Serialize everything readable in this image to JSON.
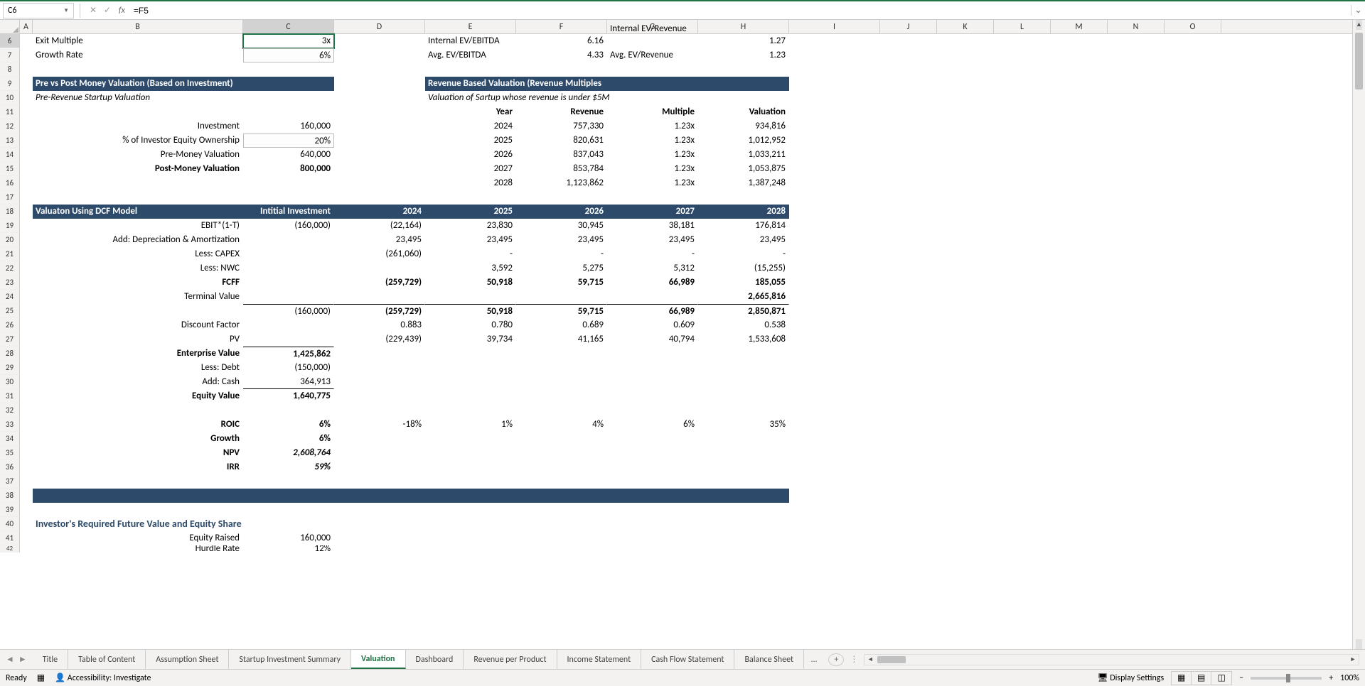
{
  "nameBox": "C6",
  "formula": "=F5",
  "statusReady": "Ready",
  "accessibility": "Accessibility: Investigate",
  "displaySettings": "Display Settings",
  "zoom": "100%",
  "colLabels": [
    "A",
    "B",
    "C",
    "D",
    "E",
    "F",
    "G",
    "H",
    "I",
    "J",
    "K",
    "L",
    "M",
    "N",
    "O"
  ],
  "rowStart": 6,
  "rows": {
    "r6": {
      "B": "Exit Multiple",
      "C": "3x",
      "E": "Internal EV/EBITDA",
      "F": "6.16",
      "G_over": "Internal EV/Revenue",
      "H": "1.27"
    },
    "r7": {
      "B": "Growth Rate",
      "C": "6%",
      "E": "Avg. EV/EBITDA",
      "F": "4.33",
      "G": "Avg. EV/Revenue",
      "H": "1.23"
    },
    "r9": {
      "B": "Pre vs Post Money Valuation (Based on Investment)",
      "E": "Revenue Based Valuation (Revenue Multiples"
    },
    "r10": {
      "B": "Pre-Revenue Startup Valuation",
      "E": "Valuation of Sartup whose revenue is under $5M"
    },
    "r11": {
      "E": "Year",
      "F": "Revenue",
      "G": "Multiple",
      "H": "Valuation"
    },
    "r12": {
      "B": "Investment",
      "C": "160,000",
      "E": "2024",
      "F": "757,330",
      "G": "1.23x",
      "H": "934,816"
    },
    "r13": {
      "B": "% of Investor Equity Ownership",
      "C": "20%",
      "E": "2025",
      "F": "820,631",
      "G": "1.23x",
      "H": "1,012,952"
    },
    "r14": {
      "B": "Pre-Money Valuation",
      "C": "640,000",
      "E": "2026",
      "F": "837,043",
      "G": "1.23x",
      "H": "1,033,211"
    },
    "r15": {
      "B": "Post-Money Valuation",
      "C": "800,000",
      "E": "2027",
      "F": "853,784",
      "G": "1.23x",
      "H": "1,053,875"
    },
    "r16": {
      "E": "2028",
      "F": "1,123,862",
      "G": "1.23x",
      "H": "1,387,248"
    },
    "r18": {
      "B": "Valuaton Using DCF Model",
      "C": "Intitial Investment",
      "D": "2024",
      "E": "2025",
      "F": "2026",
      "G": "2027",
      "H": "2028"
    },
    "r19": {
      "B": "EBIT*(1-T)",
      "C": "(160,000)",
      "D": "(22,164)",
      "E": "23,830",
      "F": "30,945",
      "G": "38,181",
      "H": "176,814"
    },
    "r20": {
      "B": "Add: Depreciation & Amortization",
      "D": "23,495",
      "E": "23,495",
      "F": "23,495",
      "G": "23,495",
      "H": "23,495"
    },
    "r21": {
      "B": "Less: CAPEX",
      "D": "(261,060)",
      "E": "-",
      "F": "-",
      "G": "-",
      "H": "-"
    },
    "r22": {
      "B": "Less: NWC",
      "E": "3,592",
      "F": "5,275",
      "G": "5,312",
      "H": "(15,255)"
    },
    "r23": {
      "B": "FCFF",
      "D": "(259,729)",
      "E": "50,918",
      "F": "59,715",
      "G": "66,989",
      "H": "185,055"
    },
    "r24": {
      "B": "Terminal Value",
      "H": "2,665,816"
    },
    "r25": {
      "C": "(160,000)",
      "D": "(259,729)",
      "E": "50,918",
      "F": "59,715",
      "G": "66,989",
      "H": "2,850,871"
    },
    "r26": {
      "B": "Discount Factor",
      "D": "0.883",
      "E": "0.780",
      "F": "0.689",
      "G": "0.609",
      "H": "0.538"
    },
    "r27": {
      "B": "PV",
      "D": "(229,439)",
      "E": "39,734",
      "F": "41,165",
      "G": "40,794",
      "H": "1,533,608"
    },
    "r28": {
      "B": "Enterprise Value",
      "C": "1,425,862"
    },
    "r29": {
      "B": "Less: Debt",
      "C": "(150,000)"
    },
    "r30": {
      "B": "Add: Cash",
      "C": "364,913"
    },
    "r31": {
      "B": "Equity Value",
      "C": "1,640,775"
    },
    "r33": {
      "B": "ROIC",
      "C": "6%",
      "D": "-18%",
      "E": "1%",
      "F": "4%",
      "G": "6%",
      "H": "35%"
    },
    "r34": {
      "B": "Growth",
      "C": "6%"
    },
    "r35": {
      "B": "NPV",
      "C": "2,608,764"
    },
    "r36": {
      "B": "IRR",
      "C": "59%"
    },
    "r40": {
      "B": "Investor's Required Future Value and Equity Share"
    },
    "r41": {
      "B": "Equity Raised",
      "C": "160,000"
    },
    "r42": {
      "B": "Hurdle Rate",
      "C": "12%"
    }
  },
  "tabs": [
    "Title",
    "Table of Content",
    "Assumption Sheet",
    "Startup Investment Summary",
    "Valuation",
    "Dashboard",
    "Revenue per Product",
    "Income Statement",
    "Cash Flow Statement",
    "Balance Sheet"
  ],
  "activeTab": "Valuation"
}
